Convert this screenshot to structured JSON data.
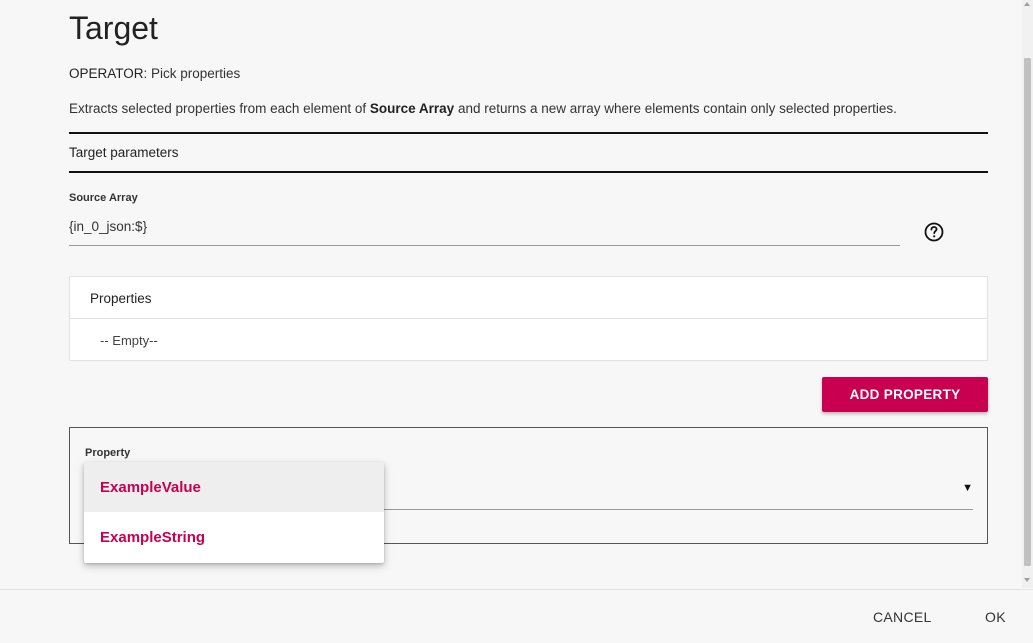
{
  "dialog": {
    "title": "Target",
    "operator_key": "OPERATOR",
    "operator_value": ": Pick properties",
    "description_pre": "Extracts selected properties from each element of ",
    "description_bold": "Source Array",
    "description_post": " and returns a new array where elements contain only selected properties."
  },
  "section": {
    "title": "Target parameters"
  },
  "source_array": {
    "label": "Source Array",
    "value": "{in_0_json:$}",
    "help_icon": "question-circle-icon"
  },
  "properties_table": {
    "header": "Properties",
    "empty_text": "-- Empty--"
  },
  "add_property_button": "ADD PROPERTY",
  "property_field": {
    "label": "Property",
    "selected_value": "",
    "caret_icon": "caret-down-icon",
    "options": [
      "ExampleValue",
      "ExampleString"
    ],
    "highlighted_index": 0
  },
  "footer": {
    "cancel_label": "CANCEL",
    "ok_label": "OK"
  },
  "colors": {
    "accent": "#c8004f",
    "background": "#f7f7f7"
  }
}
